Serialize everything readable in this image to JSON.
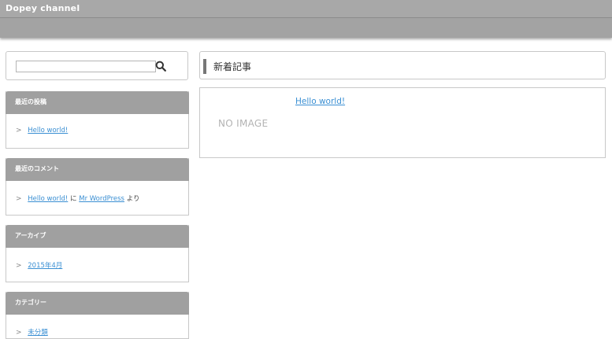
{
  "site": {
    "title": "Dopey channel"
  },
  "search": {
    "placeholder": "",
    "value": ""
  },
  "sidebar": {
    "recent_posts": {
      "title": "最近の投稿",
      "items": [
        {
          "label": "Hello world!"
        }
      ]
    },
    "recent_comments": {
      "title": "最近のコメント",
      "items": [
        {
          "post": "Hello world!",
          "on": "に",
          "author": "Mr WordPress",
          "by": "より"
        }
      ]
    },
    "archives": {
      "title": "アーカイブ",
      "items": [
        {
          "label": "2015年4月"
        }
      ]
    },
    "categories": {
      "title": "カテゴリー",
      "items": [
        {
          "label": "未分類"
        }
      ]
    }
  },
  "main": {
    "heading": "新着記事",
    "posts": [
      {
        "title": "Hello world!",
        "thumbnail_text": "NO IMAGE"
      }
    ]
  },
  "icons": {
    "search": "search-icon",
    "chevron": "chevron-right-icon"
  },
  "colors": {
    "header": "#a8a8a8",
    "widget_title": "#a0a0a0",
    "link": "#3a8fd3"
  }
}
